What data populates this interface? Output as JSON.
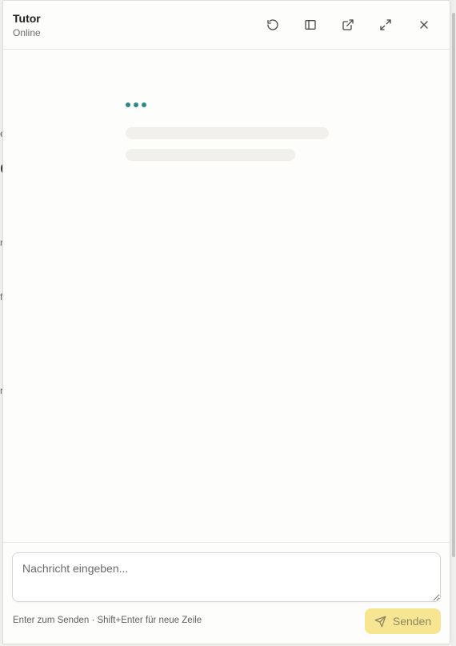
{
  "header": {
    "title": "Tutor",
    "status": "Online",
    "buttons": [
      {
        "icon": "refresh-icon"
      },
      {
        "icon": "sidebar-icon"
      },
      {
        "icon": "external-link-icon"
      },
      {
        "icon": "expand-icon"
      },
      {
        "icon": "close-icon"
      }
    ]
  },
  "chat": {
    "typing_indicator_color": "#2e8b84"
  },
  "composer": {
    "placeholder": "Nachricht eingeben...",
    "hint": "Enter zum Senden · Shift+Enter für neue Zeile",
    "send_label": "Senden",
    "send_color": "#f8e592"
  },
  "background_fragments": [
    "e",
    "e",
    "r",
    "fi",
    "n"
  ]
}
